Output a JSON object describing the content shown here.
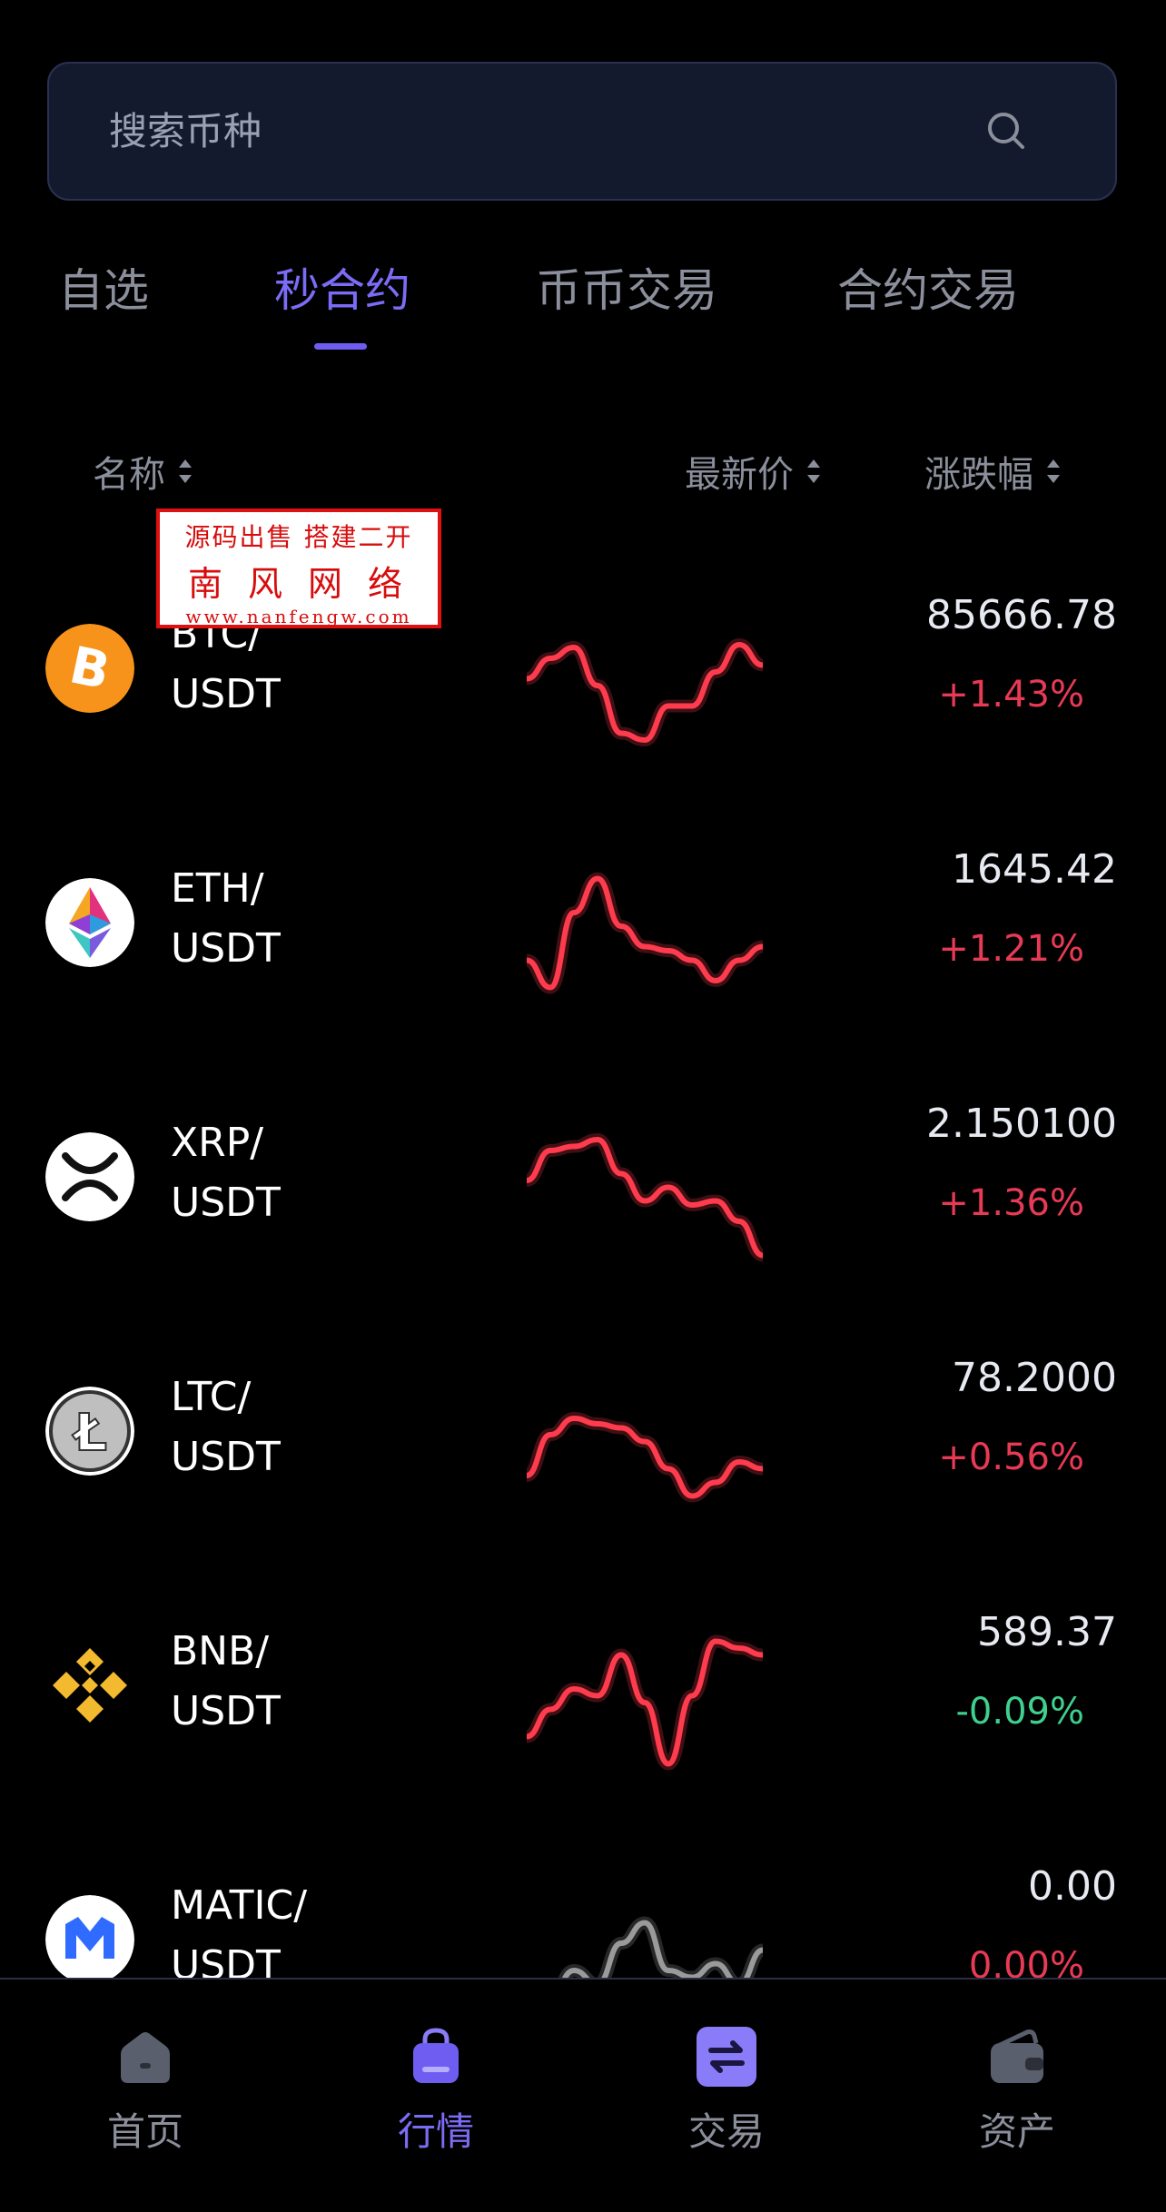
{
  "search": {
    "placeholder": "搜索币种"
  },
  "tabs": [
    {
      "label": "自选",
      "active": false
    },
    {
      "label": "秒合约",
      "active": true
    },
    {
      "label": "币币交易",
      "active": false
    },
    {
      "label": "合约交易",
      "active": false
    }
  ],
  "columns": {
    "name": "名称",
    "price": "最新价",
    "change": "涨跌幅"
  },
  "watermark": {
    "line1": "源码出售 搭建二开",
    "line2": "南风网络",
    "line3": "www.nanfengw.com"
  },
  "rows": [
    {
      "base": "BTC/",
      "quote": "USDT",
      "price": "85666.78",
      "change": "+1.43%",
      "direction": "up",
      "icon": "bitcoin-icon",
      "color": "#f7931a",
      "spark": [
        0.55,
        0.7,
        0.78,
        0.5,
        0.15,
        0.1,
        0.35,
        0.35,
        0.6,
        0.8,
        0.65
      ]
    },
    {
      "base": "ETH/",
      "quote": "USDT",
      "price": "1645.42",
      "change": "+1.21%",
      "direction": "up",
      "icon": "ethereum-icon",
      "color": "#627eea",
      "spark": [
        0.35,
        0.15,
        0.7,
        0.95,
        0.6,
        0.45,
        0.42,
        0.35,
        0.2,
        0.35,
        0.45
      ]
    },
    {
      "base": "XRP/",
      "quote": "USDT",
      "price": "2.150100",
      "change": "+1.36%",
      "direction": "up",
      "icon": "xrp-icon",
      "color": "#ffffff",
      "spark": [
        0.6,
        0.82,
        0.85,
        0.9,
        0.65,
        0.45,
        0.55,
        0.42,
        0.45,
        0.3,
        0.05
      ]
    },
    {
      "base": "LTC/",
      "quote": "USDT",
      "price": "78.2000",
      "change": "+0.56%",
      "direction": "up",
      "icon": "litecoin-icon",
      "color": "#bfbfbf",
      "spark": [
        0.3,
        0.6,
        0.72,
        0.68,
        0.65,
        0.55,
        0.35,
        0.15,
        0.25,
        0.4,
        0.35
      ]
    },
    {
      "base": "BNB/",
      "quote": "USDT",
      "price": "589.37",
      "change": "-0.09%",
      "direction": "down",
      "icon": "bnb-icon",
      "color": "#f3ba2f",
      "spark": [
        0.25,
        0.45,
        0.6,
        0.55,
        0.85,
        0.5,
        0.05,
        0.55,
        0.95,
        0.9,
        0.85
      ]
    },
    {
      "base": "MATIC/",
      "quote": "USDT",
      "price": "0.00",
      "change": "0.00%",
      "direction": "flat",
      "icon": "polygon-icon",
      "color": "#2f6bff",
      "spark": [
        0.05,
        0.2,
        0.4,
        0.3,
        0.6,
        0.75,
        0.4,
        0.35,
        0.45,
        0.3,
        0.55
      ]
    }
  ],
  "nav": [
    {
      "label": "首页",
      "icon": "home-icon",
      "active": false
    },
    {
      "label": "行情",
      "icon": "market-icon",
      "active": true
    },
    {
      "label": "交易",
      "icon": "trade-icon",
      "active": false
    },
    {
      "label": "资产",
      "icon": "wallet-icon",
      "active": false
    }
  ],
  "colors": {
    "accent": "#7b6cf6",
    "up": "#e83a55",
    "down": "#3fcf8e",
    "spark_up": "#ff3b4e",
    "spark_flat": "#9a9a9a"
  }
}
